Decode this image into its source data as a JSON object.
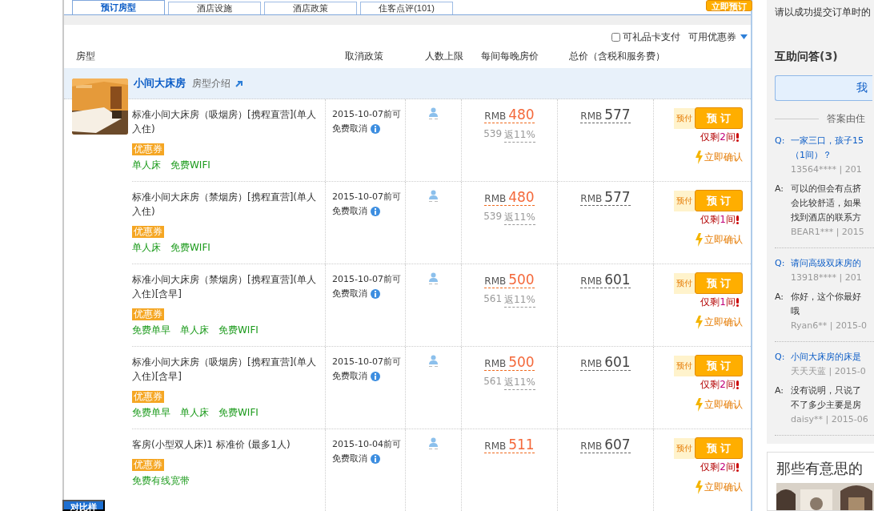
{
  "tabs": [
    {
      "label": "预订房型",
      "selected": true
    },
    {
      "label": "酒店设施",
      "selected": false
    },
    {
      "label": "酒店政策",
      "selected": false
    },
    {
      "label": "住客点评(101)",
      "selected": false
    }
  ],
  "book_now_button": "立即预订",
  "filters": {
    "gift_card": {
      "label": "可礼品卡支付",
      "checked": false
    },
    "coupon_dropdown": "可用优惠券"
  },
  "columns": [
    "房型",
    "取消政策",
    "人数上限",
    "每间每晚房价",
    "总价（含税和服务费）"
  ],
  "room_group": {
    "title": "小间大床房",
    "intro_link": "房型介绍",
    "rows": [
      {
        "name": "标准小间大床房（吸烟房）[携程直营](单人入住)",
        "tag": "优惠券",
        "features": [
          "单人床",
          "免费WIFI"
        ],
        "cancel_date": "2015-10-07前可",
        "cancel_note": "免费取消",
        "price_currency": "RMB",
        "price": "480",
        "original_price": "539",
        "rebate": "返11%",
        "total_currency": "RMB",
        "total": "577",
        "prepay": "预付",
        "book_button": "预 订",
        "remaining": {
          "prefix": "仅剩",
          "count": "2",
          "suffix": "间"
        },
        "confirm": "立即确认"
      },
      {
        "name": "标准小间大床房（禁烟房）[携程直营](单人入住)",
        "tag": "优惠券",
        "features": [
          "单人床",
          "免费WIFI"
        ],
        "cancel_date": "2015-10-07前可",
        "cancel_note": "免费取消",
        "price_currency": "RMB",
        "price": "480",
        "original_price": "539",
        "rebate": "返11%",
        "total_currency": "RMB",
        "total": "577",
        "prepay": "预付",
        "book_button": "预 订",
        "remaining": {
          "prefix": "仅剩",
          "count": "1",
          "suffix": "间"
        },
        "confirm": "立即确认"
      },
      {
        "name": "标准小间大床房（禁烟房）[携程直营](单人入住)[含早]",
        "tag": "优惠券",
        "features": [
          "免费单早",
          "单人床",
          "免费WIFI"
        ],
        "cancel_date": "2015-10-07前可",
        "cancel_note": "免费取消",
        "price_currency": "RMB",
        "price": "500",
        "original_price": "561",
        "rebate": "返11%",
        "total_currency": "RMB",
        "total": "601",
        "prepay": "预付",
        "book_button": "预 订",
        "remaining": {
          "prefix": "仅剩",
          "count": "1",
          "suffix": "间"
        },
        "confirm": "立即确认"
      },
      {
        "name": "标准小间大床房（吸烟房）[携程直营](单人入住)[含早]",
        "tag": "优惠券",
        "features": [
          "免费单早",
          "单人床",
          "免费WIFI"
        ],
        "cancel_date": "2015-10-07前可",
        "cancel_note": "免费取消",
        "price_currency": "RMB",
        "price": "500",
        "original_price": "561",
        "rebate": "返11%",
        "total_currency": "RMB",
        "total": "601",
        "prepay": "预付",
        "book_button": "预 订",
        "remaining": {
          "prefix": "仅剩",
          "count": "2",
          "suffix": "间"
        },
        "confirm": "立即确认"
      },
      {
        "name": "客房(小型双人床)1 标准价 (最多1人)",
        "tag": "优惠券",
        "features": [
          "免费有线宽带"
        ],
        "cancel_date": "2015-10-04前可",
        "cancel_note": "免费取消",
        "price_currency": "RMB",
        "price": "511",
        "total_currency": "RMB",
        "total": "607",
        "prepay": "预付",
        "book_button": "预 订",
        "remaining": {
          "prefix": "仅剩",
          "count": "2",
          "suffix": "间"
        },
        "confirm": "立即确认"
      }
    ]
  },
  "compare_button": "对比样",
  "sidebar": {
    "notice": "请以成功提交订单时的",
    "qa_title": "互助问答",
    "qa_count": "(3)",
    "ask_button": "我",
    "answer_note": "答案由住",
    "questions": [
      {
        "q_label": "Q:",
        "question": [
          "一家三口，孩子15",
          "（1间）？"
        ],
        "asker": "13564**** | 201",
        "a_label": "A:",
        "answer": [
          "可以的但会有点挤",
          "会比较舒适，如果",
          "找到酒店的联系方"
        ],
        "answerer": "BEAR1*** | 2015"
      },
      {
        "q_label": "Q:",
        "question": [
          "请问高级双床房的"
        ],
        "asker": "13918**** | 201",
        "a_label": "A:",
        "answer": [
          "你好，这个你最好",
          "哦"
        ],
        "answerer": "Ryan6** | 2015-0"
      },
      {
        "q_label": "Q:",
        "question": [
          "小间大床房的床是"
        ],
        "asker": "天天天蓝 | 2015-0",
        "a_label": "A:",
        "answer": [
          "没有说明，只说了",
          "不了多少主要是房"
        ],
        "answerer": "daisy** | 2015-06"
      }
    ]
  },
  "feature_card": {
    "title": "那些有意思的"
  }
}
